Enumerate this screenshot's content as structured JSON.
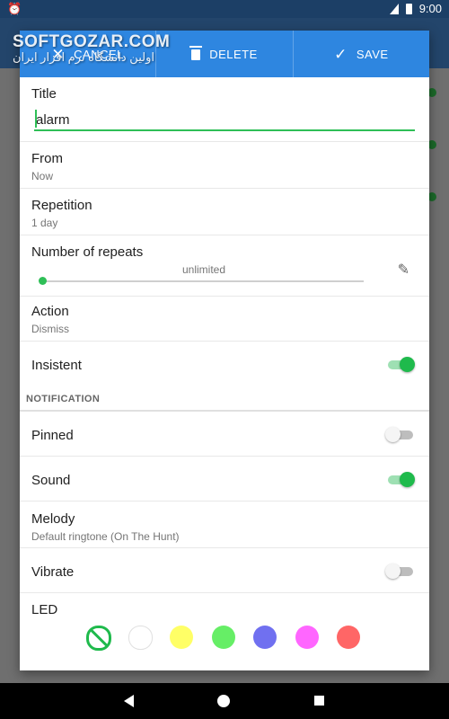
{
  "status_bar": {
    "time": "9:00",
    "alarm_icon": "alarm-clock-icon",
    "wifi_icon": "wifi-icon",
    "battery_icon": "battery-icon"
  },
  "watermark": {
    "text": "SOFTGOZAR.COM",
    "subtitle": "اولین دانشگاه نرم افزار ایران"
  },
  "toolbar": {
    "cancel_label": "CANCEL",
    "delete_label": "DELETE",
    "save_label": "SAVE",
    "accent": "#2e86e0"
  },
  "form": {
    "title_label": "Title",
    "title_value": "alarm",
    "from_label": "From",
    "from_value": "Now",
    "repetition_label": "Repetition",
    "repetition_value": "1 day",
    "repeats_label": "Number of repeats",
    "repeats_value": "unlimited",
    "action_label": "Action",
    "action_value": "Dismiss",
    "insistent_label": "Insistent",
    "insistent_on": true
  },
  "notification": {
    "header": "NOTIFICATION",
    "pinned_label": "Pinned",
    "pinned_on": false,
    "sound_label": "Sound",
    "sound_on": true,
    "melody_label": "Melody",
    "melody_value": "Default ringtone (On The Hunt)",
    "vibrate_label": "Vibrate",
    "vibrate_on": false,
    "led_label": "LED",
    "led_colors": [
      "none",
      "#ffffff",
      "#ffff66",
      "#66ee66",
      "#7070f0",
      "#ff66ff",
      "#ff6666"
    ]
  },
  "colors": {
    "switch_on": "#1fba4c",
    "underline": "#2fbf57"
  }
}
